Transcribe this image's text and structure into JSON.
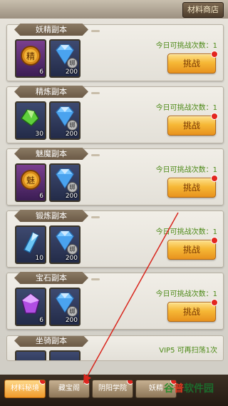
{
  "header": {
    "shop_tab": "材料商店"
  },
  "colors": {
    "accent_green": "#4d8a18",
    "button_orange": "#f6b836",
    "badge_red": "#e2251f"
  },
  "cards": [
    {
      "title": "妖精副本",
      "daily": "今日可挑战次数：1",
      "button": "挑战",
      "item1": {
        "icon": "spirit-token-icon",
        "glyph": "精",
        "count": "6"
      },
      "item2": {
        "icon": "diamond-icon",
        "bind": "绑",
        "count": "200"
      }
    },
    {
      "title": "精炼副本",
      "daily": "今日可挑战次数：1",
      "button": "挑战",
      "item1": {
        "icon": "green-crystal-icon",
        "count": "30"
      },
      "item2": {
        "icon": "diamond-icon",
        "bind": "绑",
        "count": "200"
      }
    },
    {
      "title": "魅魔副本",
      "daily": "今日可挑战次数：1",
      "button": "挑战",
      "item1": {
        "icon": "charm-token-icon",
        "glyph": "魅",
        "count": "6"
      },
      "item2": {
        "icon": "diamond-icon",
        "bind": "绑",
        "count": "200"
      }
    },
    {
      "title": "锻炼副本",
      "daily": "今日可挑战次数：1",
      "button": "挑战",
      "item1": {
        "icon": "blue-crystal-icon",
        "count": "10"
      },
      "item2": {
        "icon": "diamond-icon",
        "bind": "绑",
        "count": "200"
      }
    },
    {
      "title": "宝石副本",
      "daily": "今日可挑战次数：1",
      "button": "挑战",
      "item1": {
        "icon": "purple-gem-icon",
        "count": "6"
      },
      "item2": {
        "icon": "diamond-icon",
        "bind": "绑",
        "count": "200"
      }
    }
  ],
  "partial_card": {
    "title": "坐骑副本",
    "vip_note": "VIP5 可再扫荡1次"
  },
  "bottom_tabs": [
    {
      "label": "材料秘境",
      "active": true
    },
    {
      "label": "藏宝阁",
      "active": false
    },
    {
      "label": "阴阳学院",
      "active": false
    },
    {
      "label": "妖精",
      "active": false
    }
  ],
  "watermark": {
    "part_a": "谷",
    "part_b": "普",
    "part_c": "软件园"
  }
}
